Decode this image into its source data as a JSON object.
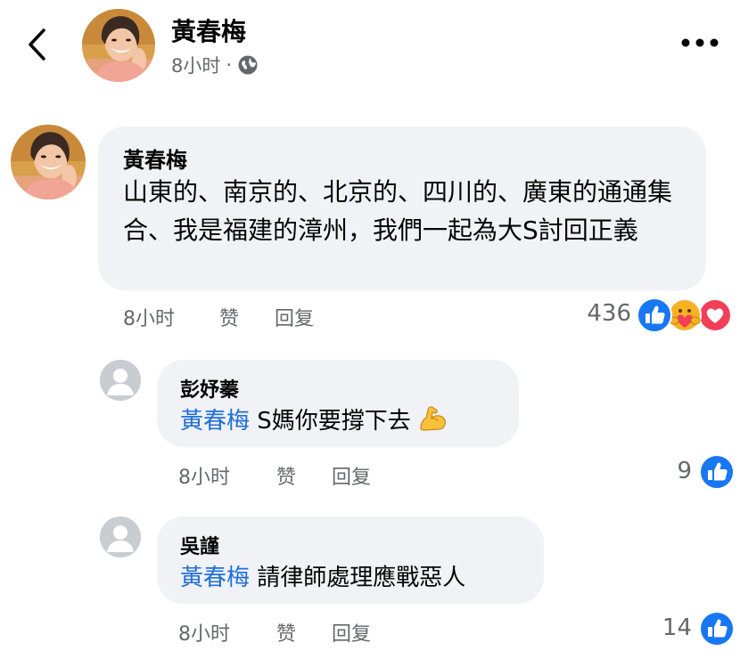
{
  "header": {
    "author": "黃春梅",
    "time": "8小时",
    "dot": "·",
    "globe_icon": "globe-icon",
    "back_icon": "chevron-left-icon",
    "more_icon": "more-horizontal-icon"
  },
  "main_comment": {
    "author": "黃春梅",
    "text": "山東的、南京的、北京的、四川的、廣東的通通集合、我是福建的漳州，我們一起為大S討回正義",
    "time": "8小时",
    "like_label": "赞",
    "reply_label": "回复",
    "reaction_count": "436",
    "reactions": [
      "like-icon",
      "care-icon",
      "love-icon"
    ]
  },
  "replies": [
    {
      "author": "彭妤蓁",
      "mention": "黃春梅",
      "text": "S媽你要撐下去",
      "emoji": "flexed-biceps-icon",
      "time": "8小时",
      "like_label": "赞",
      "reply_label": "回复",
      "reaction_count": "9"
    },
    {
      "author": "吳謹",
      "mention": "黃春梅",
      "text": "請律師處理應戰惡人",
      "time": "8小时",
      "like_label": "赞",
      "reply_label": "回复",
      "reaction_count": "14"
    }
  ],
  "colors": {
    "bubble": "#f0f2f5",
    "mention": "#216fdb",
    "meta": "#65676b",
    "like_blue": "#1877f2",
    "love_red": "#f33e58"
  }
}
